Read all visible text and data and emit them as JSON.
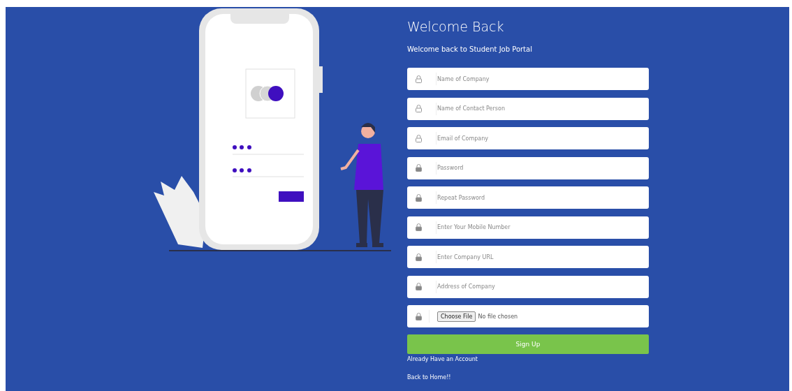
{
  "title": "Welcome Back",
  "subtitle": "Welcome back to Student Job Portal",
  "fields": [
    {
      "kind": "plain",
      "placeholder": "Name of Company"
    },
    {
      "kind": "plain",
      "placeholder": "Name of Contact Person"
    },
    {
      "kind": "plain",
      "placeholder": "Email of Company"
    },
    {
      "kind": "secure",
      "placeholder": "Password"
    },
    {
      "kind": "secure",
      "placeholder": "Repeat Password"
    },
    {
      "kind": "secure",
      "placeholder": "Enter Your Mobile Number"
    },
    {
      "kind": "secure",
      "placeholder": "Enter Company URL"
    },
    {
      "kind": "secure",
      "placeholder": "Address of Company"
    },
    {
      "kind": "file",
      "button": "Choose File",
      "status": "No file chosen"
    }
  ],
  "submit": "Sign Up",
  "links": [
    "Already Have an Account",
    "Back to Home!!"
  ]
}
